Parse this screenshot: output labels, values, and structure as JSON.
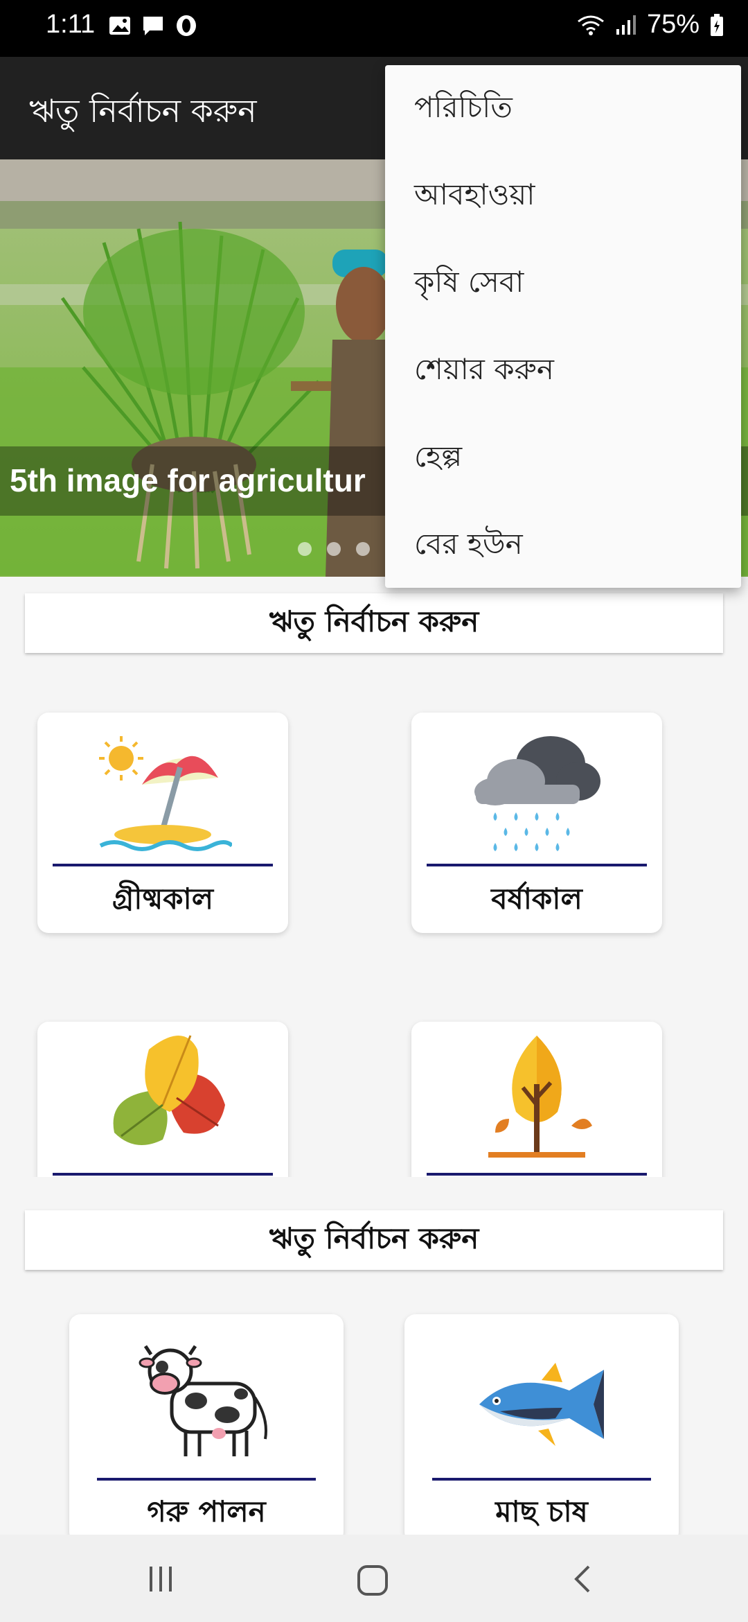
{
  "status_bar": {
    "time": "1:11",
    "battery": "75%"
  },
  "app_bar": {
    "title": "ঋতু নির্বাচন করুন"
  },
  "banner": {
    "caption": "5th image for agricultur"
  },
  "section1": {
    "header": "ঋতু নির্বাচন করুন",
    "cards": [
      {
        "label": "গ্রীষ্মকাল",
        "icon": "summer-beach-icon"
      },
      {
        "label": "বর্ষাকাল",
        "icon": "rain-cloud-icon"
      },
      {
        "label": "",
        "icon": "autumn-leaves-icon"
      },
      {
        "label": "",
        "icon": "autumn-tree-icon"
      }
    ]
  },
  "section2": {
    "header": "ঋতু নির্বাচন করুন",
    "cards": [
      {
        "label": "গরু পালন",
        "icon": "cow-icon"
      },
      {
        "label": "মাছ চাষ",
        "icon": "fish-icon"
      }
    ]
  },
  "menu": {
    "items": [
      {
        "label": "পরিচিতি"
      },
      {
        "label": "আবহাওয়া"
      },
      {
        "label": "কৃষি সেবা"
      },
      {
        "label": "শেয়ার করুন"
      },
      {
        "label": "হেল্প"
      },
      {
        "label": "বের হউন"
      }
    ]
  },
  "colors": {
    "app_bar": "#212121",
    "status_bar": "#000000",
    "rule": "#1a1a6e"
  }
}
